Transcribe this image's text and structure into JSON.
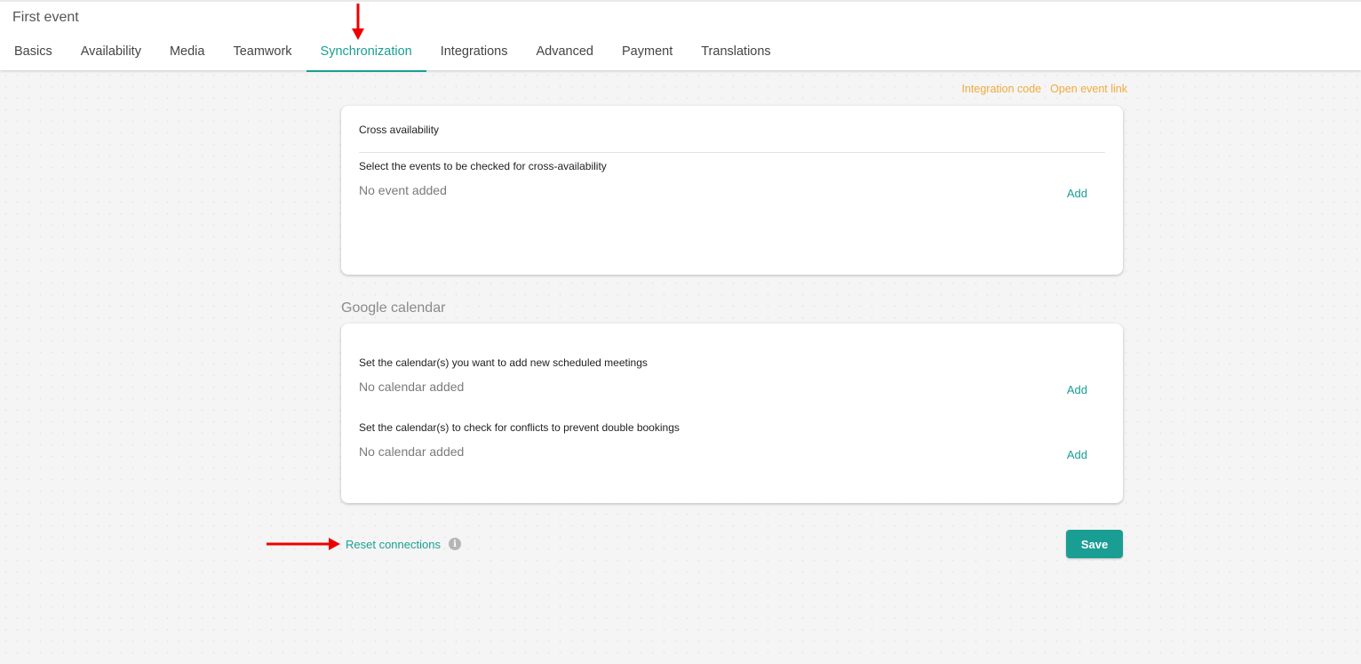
{
  "header": {
    "title": "First event",
    "tabs": [
      {
        "label": "Basics",
        "active": false
      },
      {
        "label": "Availability",
        "active": false
      },
      {
        "label": "Media",
        "active": false
      },
      {
        "label": "Teamwork",
        "active": false
      },
      {
        "label": "Synchronization",
        "active": true
      },
      {
        "label": "Integrations",
        "active": false
      },
      {
        "label": "Advanced",
        "active": false
      },
      {
        "label": "Payment",
        "active": false
      },
      {
        "label": "Translations",
        "active": false
      }
    ]
  },
  "top_links": {
    "integration_code": "Integration code",
    "open_event_link": "Open event link"
  },
  "cross_availability": {
    "heading": "Cross availability",
    "label": "Select the events to be checked for cross-availability",
    "empty": "No event added",
    "add_label": "Add"
  },
  "google_calendar": {
    "title": "Google calendar",
    "add_meetings": {
      "label": "Set the calendar(s) you want to add new scheduled meetings",
      "empty": "No calendar added",
      "add_label": "Add"
    },
    "conflicts": {
      "label": "Set the calendar(s) to check for conflicts to prevent double bookings",
      "empty": "No calendar added",
      "add_label": "Add"
    }
  },
  "footer": {
    "reset_label": "Reset connections",
    "info_icon": "i",
    "save_label": "Save"
  },
  "colors": {
    "accent": "#1a9e93",
    "link_orange": "#f0ab3c",
    "annotation_red": "#ee0000"
  }
}
